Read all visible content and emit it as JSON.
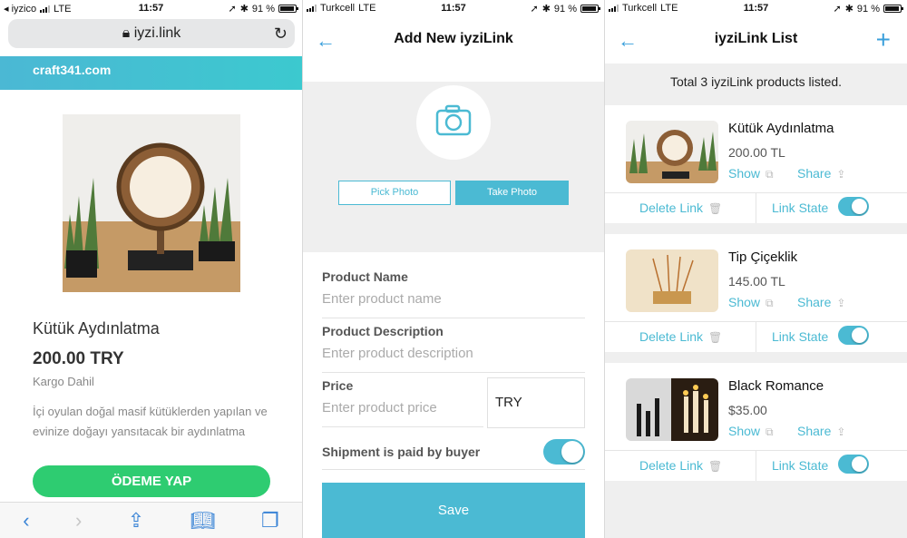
{
  "screen1": {
    "status": {
      "back_app": "iyzico",
      "carrier": "LTE",
      "time": "11:57",
      "battery": "91 %"
    },
    "url": "iyzi.link",
    "site_name": "craft341.com",
    "product": {
      "title": "Kütük Aydınlatma",
      "price": "200.00 TRY",
      "shipping": "Kargo Dahil",
      "description": "İçi oyulan doğal masif kütüklerden yapılan ve evinize doğayı yansıtacak bir aydınlatma"
    },
    "pay_button": "ÖDEME YAP",
    "toolbar_icons": [
      "back-icon",
      "forward-icon",
      "share-icon",
      "bookmarks-icon",
      "tabs-icon"
    ]
  },
  "screen2": {
    "status": {
      "carrier": "Turkcell",
      "network": "LTE",
      "time": "11:57",
      "battery": "91 %"
    },
    "title": "Add New iyziLink",
    "pick_photo": "Pick Photo",
    "take_photo": "Take Photo",
    "fields": {
      "name_label": "Product Name",
      "name_placeholder": "Enter product name",
      "desc_label": "Product Description",
      "desc_placeholder": "Enter product description",
      "price_label": "Price",
      "price_placeholder": "Enter product price",
      "currency": "TRY"
    },
    "shipment_label": "Shipment is paid by buyer",
    "shipment_on": true,
    "save": "Save"
  },
  "screen3": {
    "status": {
      "carrier": "Turkcell",
      "network": "LTE",
      "time": "11:57",
      "battery": "91 %"
    },
    "title": "iyziLink List",
    "total": "Total 3 iyziLink products listed.",
    "items": [
      {
        "name": "Kütük Aydınlatma",
        "price": "200.00 TL",
        "show": "Show",
        "share": "Share",
        "delete": "Delete Link",
        "state": "Link State",
        "enabled": true
      },
      {
        "name": "Tip Çiçeklik",
        "price": "145.00 TL",
        "show": "Show",
        "share": "Share",
        "delete": "Delete Link",
        "state": "Link State",
        "enabled": true
      },
      {
        "name": "Black Romance",
        "price": "$35.00",
        "show": "Show",
        "share": "Share",
        "delete": "Delete Link",
        "state": "Link State",
        "enabled": true
      }
    ]
  },
  "colors": {
    "accent": "#4bbad3",
    "pay_green": "#2ecc71",
    "link_blue": "#3a9fdb"
  }
}
